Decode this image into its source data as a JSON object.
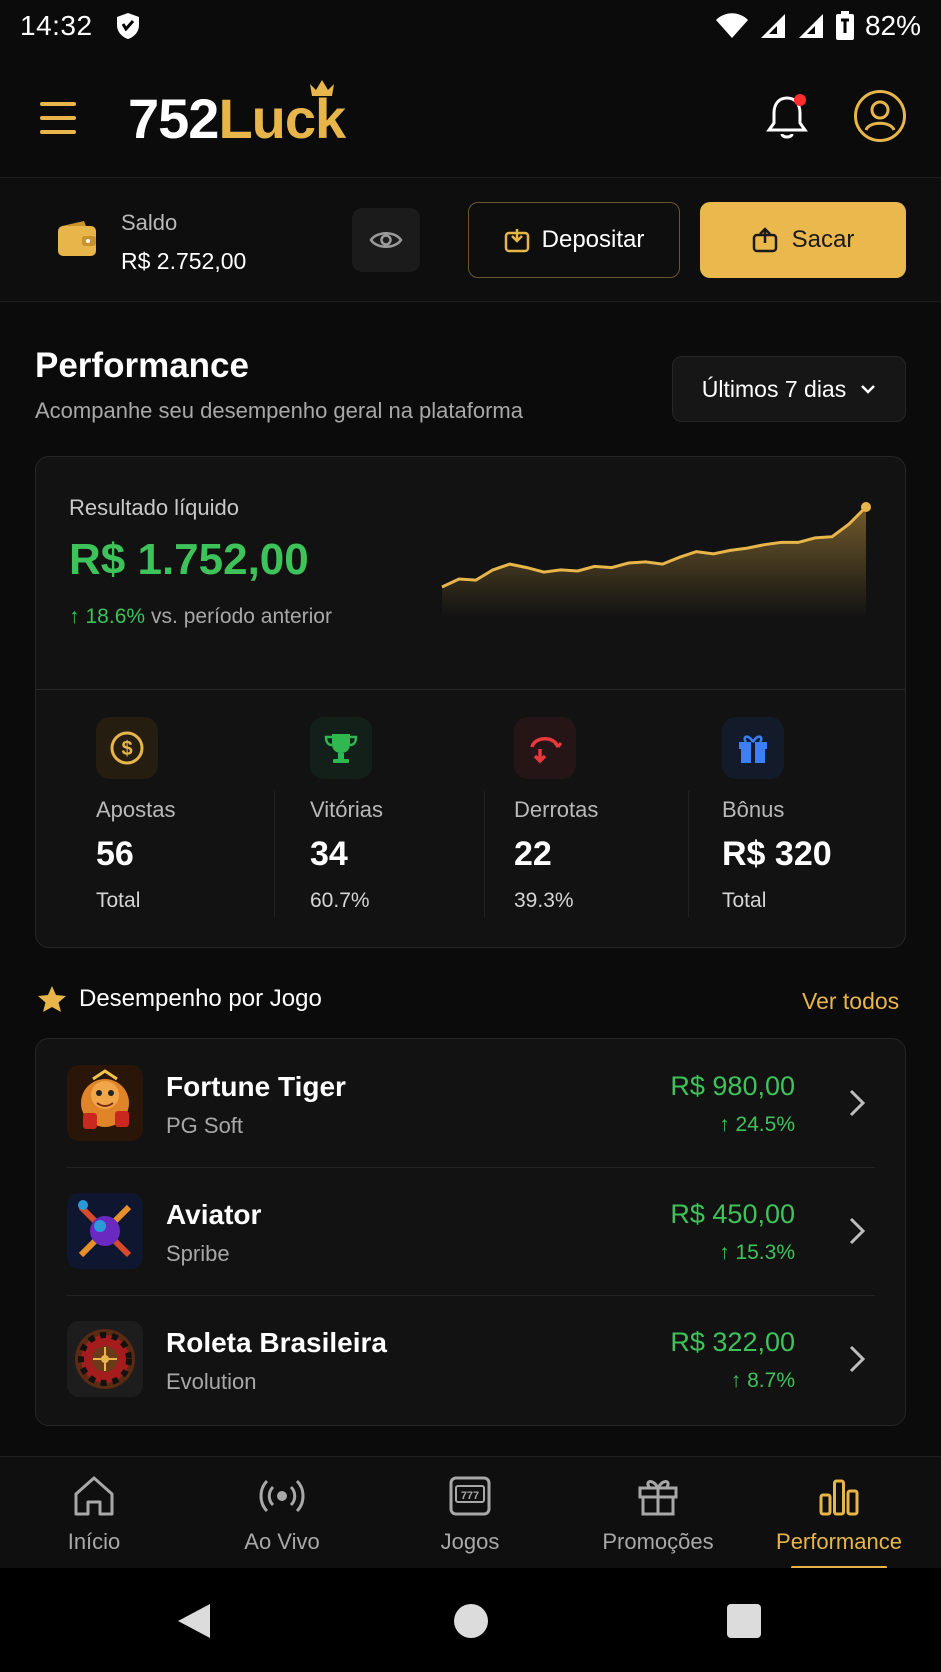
{
  "status_bar": {
    "time": "14:32",
    "battery": "82%"
  },
  "header": {
    "logo_part1": "752",
    "logo_part2": "Luck"
  },
  "balance": {
    "label": "Saldo",
    "value": "R$ 2.752,00",
    "deposit_label": "Depositar",
    "withdraw_label": "Sacar"
  },
  "performance": {
    "title": "Performance",
    "subtitle": "Acompanhe seu desempenho geral na plataforma",
    "period": "Últimos 7 dias",
    "net_label": "Resultado líquido",
    "net_value": "R$ 1.752,00",
    "net_change": "18.6%",
    "net_change_text": "vs. período anterior",
    "sparkline": [
      1.0,
      1.35,
      1.3,
      1.75,
      2.0,
      1.85,
      1.65,
      1.75,
      1.7,
      1.9,
      1.85,
      2.05,
      2.1,
      2.0,
      2.3,
      2.55,
      2.45,
      2.6,
      2.7,
      2.85,
      2.95,
      2.95,
      3.15,
      3.2,
      3.75,
      4.5
    ],
    "stats": [
      {
        "label": "Apostas",
        "value": "56",
        "sub": "Total",
        "icon": "dollar-coin-icon",
        "color": "#e7b54a"
      },
      {
        "label": "Vitórias",
        "value": "34",
        "sub": "60.7%",
        "icon": "trophy-icon",
        "color": "#2fb84f"
      },
      {
        "label": "Derrotas",
        "value": "22",
        "sub": "39.3%",
        "icon": "loss-arrow-icon",
        "color": "#e8383b"
      },
      {
        "label": "Bônus",
        "value": "R$ 320",
        "sub": "Total",
        "icon": "gift-icon",
        "color": "#3a7ff6"
      }
    ]
  },
  "games": {
    "title": "Desempenho por Jogo",
    "see_all": "Ver todos",
    "items": [
      {
        "name": "Fortune Tiger",
        "provider": "PG Soft",
        "amount": "R$ 980,00",
        "change": "24.5%"
      },
      {
        "name": "Aviator",
        "provider": "Spribe",
        "amount": "R$ 450,00",
        "change": "15.3%"
      },
      {
        "name": "Roleta Brasileira",
        "provider": "Evolution",
        "amount": "R$ 322,00",
        "change": "8.7%"
      }
    ]
  },
  "bottom_nav": [
    {
      "label": "Início",
      "icon": "home-icon"
    },
    {
      "label": "Ao Vivo",
      "icon": "live-broadcast-icon"
    },
    {
      "label": "Jogos",
      "icon": "slot-machine-icon"
    },
    {
      "label": "Promoções",
      "icon": "gift-icon"
    },
    {
      "label": "Performance",
      "icon": "bar-chart-icon",
      "active": true
    }
  ],
  "colors": {
    "accent": "#e7b54a",
    "positive": "#3ec25a",
    "negative": "#e8383b",
    "bonus": "#3a7ff6",
    "background": "#0b0b0b"
  }
}
